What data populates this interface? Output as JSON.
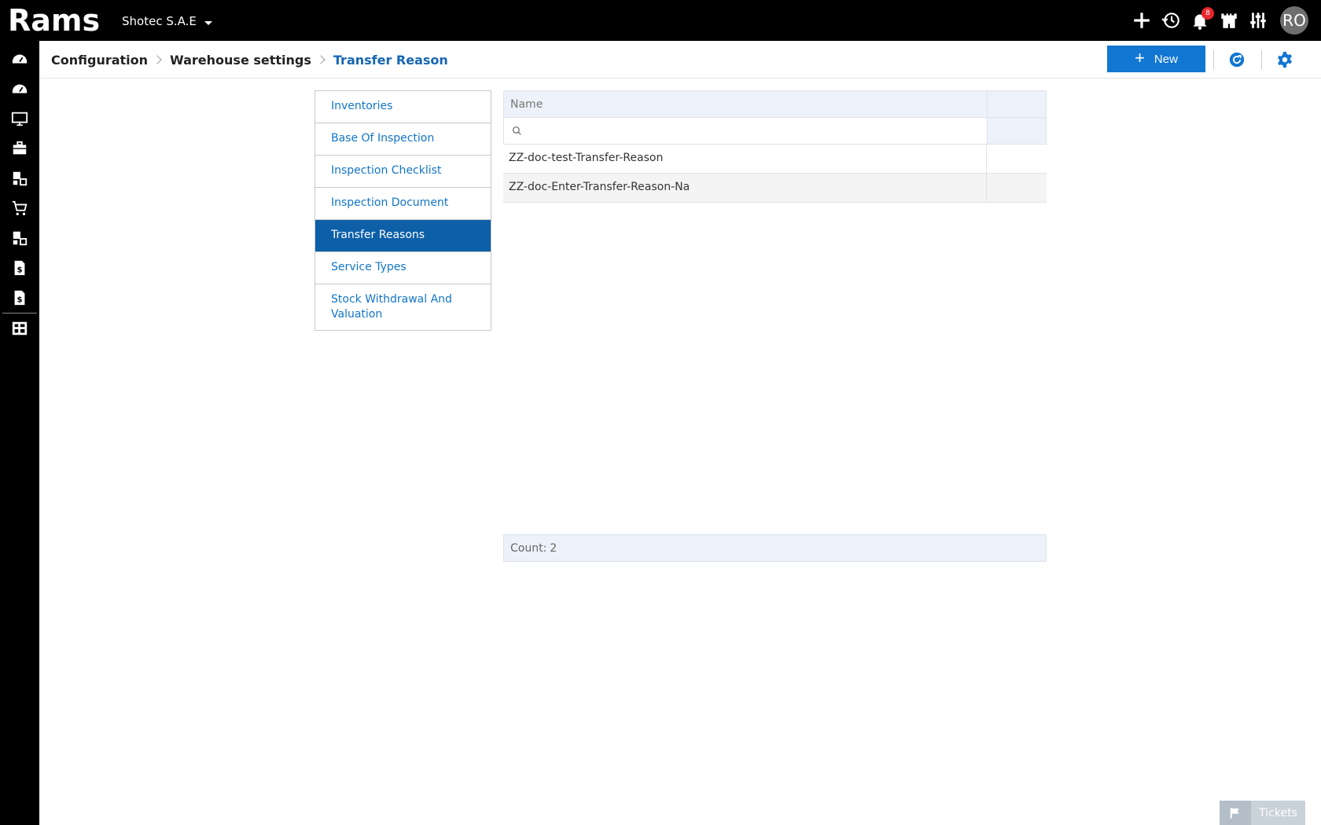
{
  "app": {
    "logo_text": "Rams",
    "company": "Shotec S.A.E"
  },
  "topbar": {
    "notification_count": "8",
    "avatar_initials": "RO",
    "icons": [
      "plus-icon",
      "history-icon",
      "bell-icon",
      "castle-icon",
      "sliders-icon"
    ]
  },
  "rail": {
    "icons": [
      "dashboard-icon",
      "dashboard-icon",
      "monitor-icon",
      "briefcase-icon",
      "modules-icon",
      "cart-icon",
      "modules-icon",
      "invoice-icon",
      "invoice-icon",
      "reports-icon"
    ]
  },
  "breadcrumb": {
    "level1": "Configuration",
    "level2": "Warehouse settings",
    "level3": "Transfer Reason"
  },
  "toolbar": {
    "new_label": "New"
  },
  "sidemenu": {
    "items": [
      {
        "label": "Inventories"
      },
      {
        "label": "Base Of Inspection"
      },
      {
        "label": "Inspection Checklist"
      },
      {
        "label": "Inspection Document"
      },
      {
        "label": "Transfer Reasons",
        "active": true
      },
      {
        "label": "Service Types"
      },
      {
        "label": "Stock Withdrawal And Valuation"
      }
    ]
  },
  "grid": {
    "column_name": "Name",
    "search_placeholder": "",
    "rows": [
      {
        "name": "ZZ-doc-test-Transfer-Reason"
      },
      {
        "name": "ZZ-doc-Enter-Transfer-Reason-Na"
      }
    ],
    "count_label": "Count:",
    "count_value": "2"
  },
  "tickets": {
    "label": "Tickets"
  },
  "colors": {
    "accent": "#1276d3",
    "active_menu": "#0d5fa8",
    "grid_header": "#edf2fa",
    "badge": "#e8262b"
  }
}
